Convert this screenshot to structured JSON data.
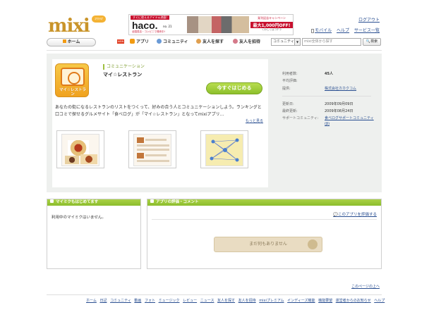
{
  "header": {
    "logo": "mixi",
    "logo_badge": "ｺﾜｸﾃﾙﾅ",
    "ad": {
      "top_tag": "すぐに使えるアイテム満載!",
      "brand": "haco.",
      "issue": "no. 21",
      "sub": "全国書店・コンビニで発売中!",
      "right_line1": "発刊記念キャンペーン",
      "right_line2": "最大1,000円OFF!",
      "right_line3": "くわしくはコチラ"
    },
    "logout": "ログアウト",
    "links": [
      "モバイル",
      "ヘルプ",
      "サービス一覧"
    ]
  },
  "nav": {
    "home": "ホーム",
    "new_badge": "NEW",
    "items": [
      "アプリ",
      "コミュニティ",
      "友人を探す",
      "友人を招待"
    ],
    "search_select": "コミュニティ",
    "search_placeholder": "mixi全体から探す",
    "search_button": "検索"
  },
  "app": {
    "icon_text": "マイ☆レストラン",
    "category": "コミュニケーション",
    "title": "マイ☆レストラン",
    "start_button": "今すぐはじめる",
    "description": "あなたの街になるレストランのリストをつくって、好みの合う人とコミュニケーションしよう。ランキングと口コミで探せるグルメサイト「食べログ」が「マイ☆レストラン」となってmixiアプリ…",
    "more": "もっと見る"
  },
  "info": {
    "rows": [
      {
        "label": "利用者数:",
        "value": "45人"
      },
      {
        "label": "平均評価:",
        "value": ""
      },
      {
        "label": "提供:",
        "value": "株式会社カカクコム"
      },
      {
        "label": "更新日:",
        "value": "2009年09月09日"
      },
      {
        "label": "最終更新:",
        "value": "2009年08月24日"
      },
      {
        "label": "サポートコミュニティ:",
        "value": "食べログサポートコミュニティ(β)"
      }
    ]
  },
  "mymixi": {
    "heading": "マイミクもはじめてます",
    "text": "利用中のマイミクはいません。"
  },
  "reviews": {
    "heading": "アプリの評価・コメント",
    "rate_link": "このアプリを評価する",
    "empty": "まだ何もありません"
  },
  "footer": {
    "page_top": "このページの上へ",
    "links": [
      "ホーム",
      "日記",
      "コミュニティ",
      "動画",
      "フォト",
      "ミュージック",
      "レビュー",
      "ニュース",
      "友人を探す",
      "友人を招待",
      "mixiプレミアム",
      "インディーズ機能",
      "機能要望",
      "運営者からのお知らせ",
      "ヘルプ"
    ]
  }
}
